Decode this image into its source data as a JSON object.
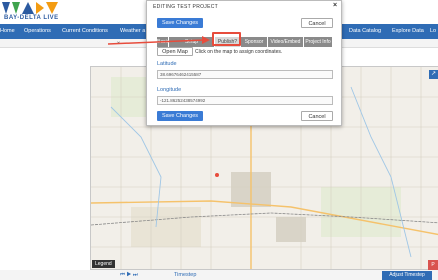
{
  "logo": {
    "text": "BAY-DELTA LIVE"
  },
  "nav": {
    "items": [
      {
        "label": "Home"
      },
      {
        "label": "Operations"
      },
      {
        "label": "Current Conditions"
      },
      {
        "label": "Weather a"
      },
      {
        "label": "Data Catalog"
      },
      {
        "label": "Explore Data"
      },
      {
        "label": "Lo"
      }
    ],
    "sub_chevron": "⌄"
  },
  "modal": {
    "title": "EDITING TEST PROJECT",
    "close": "×",
    "save_top": "Save Changes",
    "cancel_top": "Cancel",
    "tabs": [
      {
        "label": "Basic"
      },
      {
        "label": "Setup"
      },
      {
        "label": "Publish?"
      },
      {
        "label": "Sponsor"
      },
      {
        "label": "Video/Embed"
      },
      {
        "label": "Project Info"
      }
    ],
    "open_map": "Open Map",
    "hint": "Click on the map to assign coordinates.",
    "latitude": {
      "label": "Latitude",
      "value": "38.69676462415587"
    },
    "longitude": {
      "label": "Longitude",
      "value": "-121.86252438574992"
    },
    "save_bottom": "Save Changes",
    "cancel_bottom": "Cancel"
  },
  "map": {
    "legend": "Legend",
    "expand": "↗",
    "badge": "P"
  },
  "bottom": {
    "controls": "⏮  ▶  ⏭",
    "timestep": "Timestep",
    "adjust": "Adjust Timestep"
  }
}
